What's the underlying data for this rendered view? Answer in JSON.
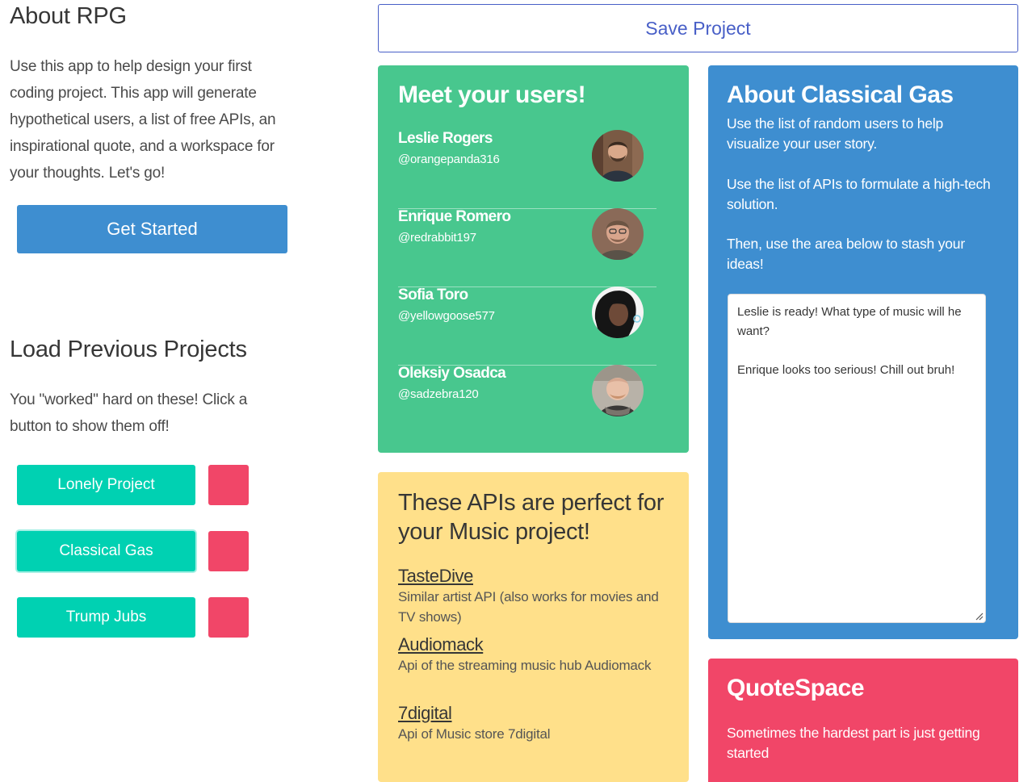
{
  "about": {
    "title": "About RPG",
    "text": "Use this app to help design your first coding project. This app will generate hypothetical users, a list of free APIs, an inspirational quote, and a workspace for your thoughts. Let's go!",
    "get_started_label": "Get Started"
  },
  "load": {
    "title": "Load Previous Projects",
    "text": "You \"worked\" hard on these! Click a button to show them off!",
    "projects": [
      {
        "label": "Lonely Project"
      },
      {
        "label": "Classical Gas"
      },
      {
        "label": "Trump Jubs"
      }
    ]
  },
  "save_label": "Save Project",
  "users": {
    "title": "Meet your users!",
    "list": [
      {
        "name": "Leslie Rogers",
        "handle": "@orangepanda316"
      },
      {
        "name": "Enrique Romero",
        "handle": "@redrabbit197"
      },
      {
        "name": "Sofia Toro",
        "handle": "@yellowgoose577"
      },
      {
        "name": "Oleksiy Osadca",
        "handle": "@sadzebra120"
      }
    ]
  },
  "apis": {
    "title": "These APIs are perfect for your Music project!",
    "list": [
      {
        "name": "TasteDive",
        "desc": "Similar artist API (also works for movies and TV shows)"
      },
      {
        "name": "Audiomack",
        "desc": "Api of the streaming music hub Audiomack"
      },
      {
        "name": "7digital",
        "desc": "Api of Music store 7digital"
      }
    ]
  },
  "about_project": {
    "title": "About Classical Gas",
    "p1": "Use the list of random users to help visualize your user story.",
    "p2": "Use the list of APIs to formulate a high-tech solution.",
    "p3": "Then, use the area below to stash your ideas!",
    "notes": "Leslie is ready! What type of music will he want?\n\nEnrique looks too serious! Chill out bruh!"
  },
  "quote": {
    "title": "QuoteSpace",
    "text": "Sometimes the hardest part is just getting started"
  },
  "colors": {
    "primary": "#3e8ed0",
    "success": "#48c78e",
    "warning": "#ffe08a",
    "danger": "#f14668",
    "turquoise": "#00d1b2",
    "link": "#485fc7"
  }
}
